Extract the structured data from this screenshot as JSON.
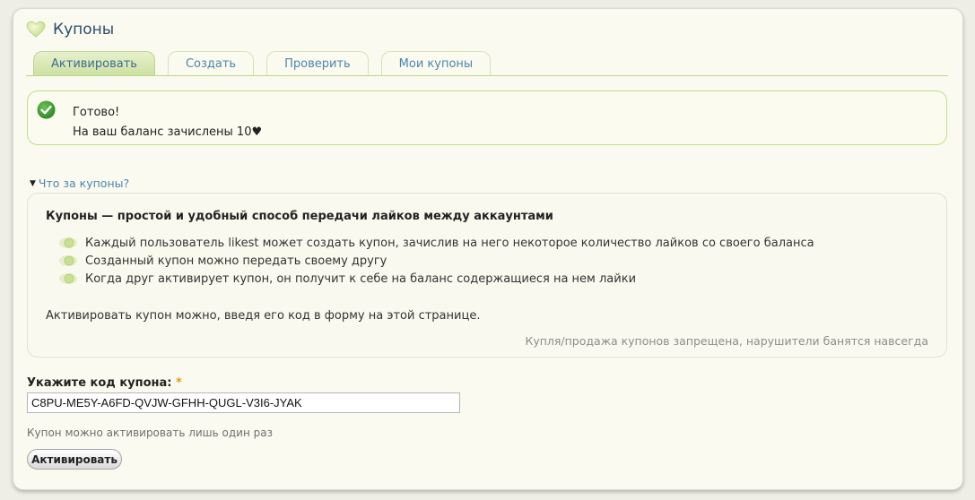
{
  "page": {
    "title": "Купоны",
    "title_icon": "heart-icon"
  },
  "tabs": [
    {
      "label": "Активировать",
      "active": true
    },
    {
      "label": "Создать",
      "active": false
    },
    {
      "label": "Проверить",
      "active": false
    },
    {
      "label": "Мои купоны",
      "active": false
    }
  ],
  "alert": {
    "icon": "check-circle-icon",
    "line1": "Готово!",
    "line2": "На ваш баланс зачислены 10♥",
    "status_color": "#3a9c2c"
  },
  "faq": {
    "toggle_label": "Что за купоны?",
    "heading": "Купоны — простой и удобный способ передачи лайков между аккаунтами",
    "items": [
      "Каждый пользователь likest может создать купон, зачислив на него некоторое количество лайков со своего баланса",
      "Созданный купон можно передать своему другу",
      "Когда друг активирует купон, он получит к себе на баланс содержащиеся на нем лайки"
    ],
    "note": "Активировать купон можно, введя его код в форму на этой странице.",
    "warning": "Купля/продажа купонов запрещена, нарушители банятся навсегда"
  },
  "form": {
    "label": "Укажите код купона:",
    "required_mark": "*",
    "code_value": "C8PU-ME5Y-A6FD-QVJW-GFHH-QUGL-V3I6-JYAK",
    "hint": "Купон можно активировать лишь один раз",
    "submit_label": "Активировать"
  },
  "colors": {
    "accent": "#4d86ad",
    "tab_border": "#bcd68a",
    "alert_border": "#bfe186"
  }
}
